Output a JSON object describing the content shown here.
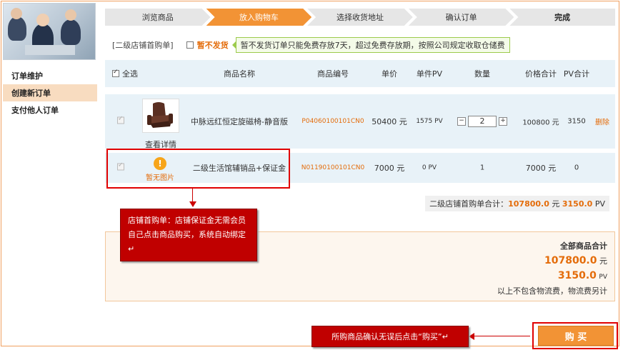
{
  "sidebar": {
    "items": [
      {
        "label": "订单维护"
      },
      {
        "label": "创建新订单"
      },
      {
        "label": "支付他人订单"
      }
    ]
  },
  "steps": [
    "浏览商品",
    "放入购物车",
    "选择收货地址",
    "确认订单",
    "完成"
  ],
  "cart": {
    "title": "[二级店铺首购单]",
    "no_delivery_label": "暂不发货",
    "tip": "暂不发货订单只能免费存放7天，超过免费存放期，按照公司规定收取仓储费"
  },
  "table": {
    "select_all": "全选",
    "headers": [
      "商品名称",
      "商品编号",
      "单价",
      "单件PV",
      "数量",
      "价格合计",
      "PV合计"
    ],
    "rows": [
      {
        "name": "中脉远红恒定旋磁椅-静音版",
        "code": "P04060100101CN0",
        "price": "50400 元",
        "pv": "1575 PV",
        "qty": "2",
        "total": "100800 元",
        "pv_total": "3150",
        "action": "删除",
        "detail": "查看详情"
      },
      {
        "name": "二级生活馆辅销品+保证金",
        "code": "N01190100101CN0",
        "price": "7000 元",
        "pv": "0 PV",
        "qty": "1",
        "total": "7000 元",
        "pv_total": "0",
        "no_image": "暂无图片"
      }
    ]
  },
  "subtotal": {
    "label": "二级店铺首购单合计：",
    "amount": "107800.0",
    "unit": "元",
    "pv": "3150.0",
    "pv_unit": "PV"
  },
  "summary": {
    "title": "全部商品合计",
    "amount": "107800.0",
    "amount_unit": "元",
    "pv": "3150.0",
    "pv_unit": "PV",
    "note": "以上不包含物流费，物流费另计"
  },
  "callouts": {
    "shop": "店铺首购单：店铺保证金无需会员自己点击商品购买，系统自动绑定↵",
    "buy": "所购商品确认无误后点击“购买”↵"
  },
  "buy_button": "购 买",
  "colors": {
    "accent": "#f29335",
    "highlight": "#e46c0a",
    "callout": "#c00000",
    "row_bg": "#e8f2f8"
  }
}
